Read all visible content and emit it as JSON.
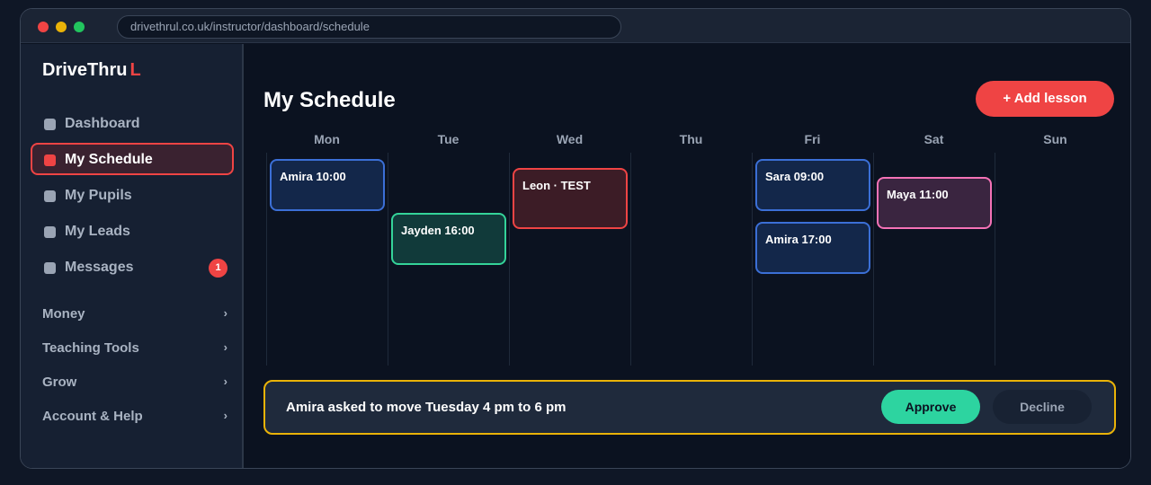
{
  "browser": {
    "url": "drivethrul.co.uk/instructor/dashboard/schedule"
  },
  "sidebar": {
    "logo_text": "DriveThru",
    "logo_accent": "L",
    "items": [
      {
        "label": "Dashboard"
      },
      {
        "label": "My Schedule",
        "active": true
      },
      {
        "label": "My Pupils"
      },
      {
        "label": "My Leads"
      },
      {
        "label": "Messages",
        "badge": "1"
      }
    ],
    "groups": [
      {
        "label": "Money",
        "chevron": "›"
      },
      {
        "label": "Teaching Tools",
        "chevron": "›"
      },
      {
        "label": "Grow",
        "chevron": "›"
      },
      {
        "label": "Account & Help",
        "chevron": "›"
      }
    ]
  },
  "main": {
    "title": "My Schedule",
    "add_button": "+ Add lesson",
    "days": [
      "Mon",
      "Tue",
      "Wed",
      "Thu",
      "Fri",
      "Sat",
      "Sun"
    ],
    "lessons": [
      {
        "label": "Amira 10:00",
        "day": "Mon",
        "color": "blue"
      },
      {
        "label": "Jayden 16:00",
        "day": "Tue",
        "color": "green"
      },
      {
        "label": "Leon · TEST",
        "day": "Wed",
        "color": "red"
      },
      {
        "label": "Sara 09:00",
        "day": "Fri",
        "color": "blue"
      },
      {
        "label": "Amira 17:00",
        "day": "Fri",
        "color": "blue"
      },
      {
        "label": "Maya 11:00",
        "day": "Sat",
        "color": "pink"
      }
    ],
    "request": {
      "message": "Amira asked to move Tuesday 4 pm to 6 pm",
      "approve": "Approve",
      "decline": "Decline"
    }
  },
  "colors": {
    "accent": "#ef4444",
    "approve": "#2dd4a0",
    "request_border": "#eab308"
  }
}
